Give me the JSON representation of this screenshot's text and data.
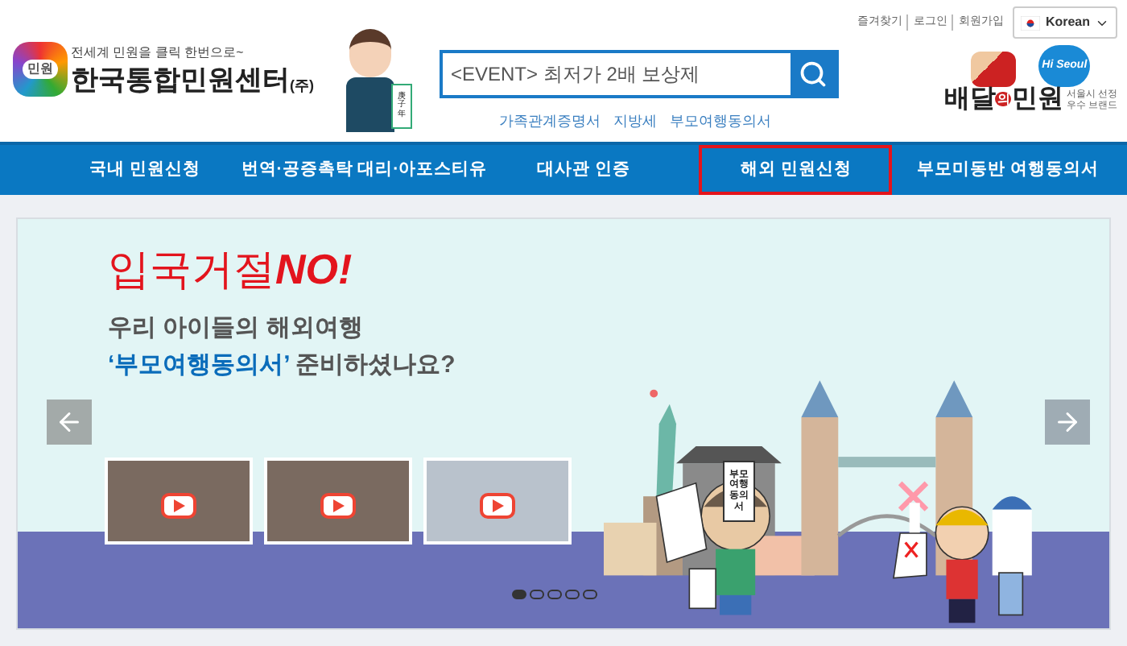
{
  "header": {
    "tagline": "전세계 민원을 클릭 한번으로~",
    "logo_text": "한국통합민원센터",
    "logo_suffix": "(주)",
    "logo_badge": "민원",
    "scroll_text": "庚子年",
    "search": {
      "value": "<EVENT> 최저가 2배 보상제"
    },
    "quick_links": [
      "가족관계증명서",
      "지방세",
      "부모여행동의서"
    ],
    "top_links": [
      "즐겨찾기",
      "로그인",
      "회원가입"
    ],
    "language": "Korean",
    "partner": {
      "name_parts": [
        "배달",
        "의",
        "민원"
      ],
      "note_lines": [
        "서울시 선정",
        "우수 브랜드"
      ],
      "badge": "Hi Seoul"
    }
  },
  "nav": [
    {
      "label": "국내 민원신청",
      "selected": false
    },
    {
      "label": "번역·공증촉탁 대리·아포스티유",
      "selected": false
    },
    {
      "label": "대사관 인증",
      "selected": false
    },
    {
      "label": "해외 민원신청",
      "selected": true
    },
    {
      "label": "부모미동반 여행동의서",
      "selected": false
    }
  ],
  "banner": {
    "headline": "입국거절",
    "headline_em": "NO!",
    "line_1": "우리 아이들의 해외여행",
    "line_2_em": "‘부모여행동의서’",
    "line_2": " 준비하셨나요?",
    "document_label": "부모 여행 동의서",
    "videos": [
      {
        "kind": "video"
      },
      {
        "kind": "video"
      },
      {
        "kind": "news"
      }
    ],
    "slides": [
      {
        "selected": true
      },
      {
        "selected": false
      },
      {
        "selected": false
      },
      {
        "selected": false
      },
      {
        "selected": false
      }
    ]
  }
}
